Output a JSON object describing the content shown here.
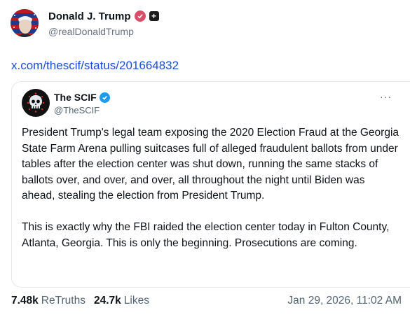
{
  "post": {
    "author": {
      "display_name": "Donald J. Trump",
      "handle": "@realDonaldTrump",
      "verified_icon": "verified-badge-icon",
      "badge_icon": "plus-icon",
      "badge_color": "#d94f6a"
    },
    "link_text": "x.com/thescif/status/201664832",
    "link_color": "#1d4ed8"
  },
  "quoted": {
    "display_name": "The SCIF",
    "handle": "@TheSCIF",
    "more_label": "···",
    "verified_color": "#1d9bf0",
    "paragraphs": [
      "President Trump's legal team exposing the 2020 Election Fraud at the Georgia State Farm Arena pulling suitcases full of alleged fraudulent ballots from under tables after the election center was shut down, running the same stacks of ballots over, and over, and over, all throughout the night until Biden was ahead, stealing the election from President Trump.",
      "This is exactly why the FBI raided the election center today in Fulton County, Atlanta, Georgia. This is only the beginning. Prosecutions are coming."
    ]
  },
  "footer": {
    "retruths_count": "7.48k",
    "retruths_label": "ReTruths",
    "likes_count": "24.7k",
    "likes_label": "Likes",
    "timestamp": "Jan 29, 2026, 11:02 AM"
  }
}
